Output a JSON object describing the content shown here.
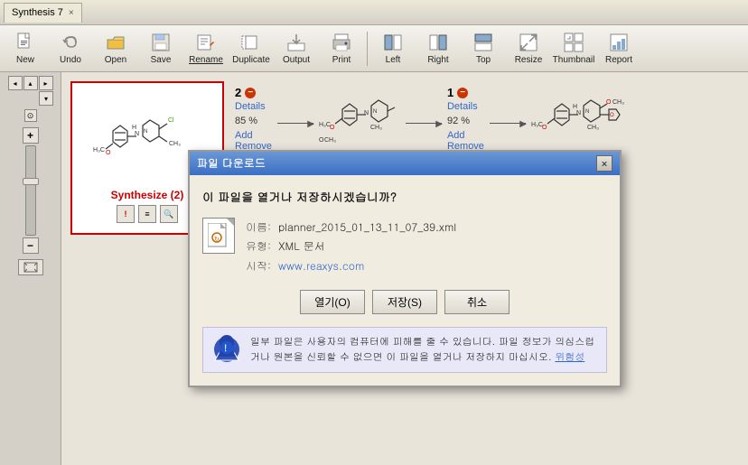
{
  "titlebar": {
    "tab_label": "Synthesis 7",
    "close_label": "×"
  },
  "toolbar": {
    "buttons": [
      {
        "id": "new",
        "label": "New",
        "icon": "📄"
      },
      {
        "id": "undo",
        "label": "Undo",
        "icon": "↩"
      },
      {
        "id": "open",
        "label": "Open",
        "icon": "📂"
      },
      {
        "id": "save",
        "label": "Save",
        "icon": "💾"
      },
      {
        "id": "rename",
        "label": "Rename",
        "icon": "✏️"
      },
      {
        "id": "duplicate",
        "label": "Duplicate",
        "icon": "⧉"
      },
      {
        "id": "output",
        "label": "Output",
        "icon": "⬆"
      },
      {
        "id": "print",
        "label": "Print",
        "icon": "🖨"
      },
      {
        "id": "left",
        "label": "Left",
        "icon": "⬅"
      },
      {
        "id": "right",
        "label": "Right",
        "icon": "➡"
      },
      {
        "id": "top",
        "label": "Top",
        "icon": "⬆"
      },
      {
        "id": "resize",
        "label": "Resize",
        "icon": "⤢"
      },
      {
        "id": "thumbnail",
        "label": "Thumbnail",
        "icon": "🖼"
      },
      {
        "id": "report",
        "label": "Report",
        "icon": "📊"
      }
    ]
  },
  "synthesis": {
    "card_label": "Synthesize (2)",
    "icons": [
      "!",
      "≡",
      "🔍"
    ]
  },
  "steps": [
    {
      "number": "2",
      "details_label": "Details",
      "percent": "85 %",
      "add_label": "Add",
      "remove_label": "Remove"
    },
    {
      "number": "1",
      "details_label": "Details",
      "percent": "92 %",
      "add_label": "Add",
      "remove_label": "Remove"
    }
  ],
  "dialog": {
    "title": "파일 다운로드",
    "close_label": "×",
    "question": "이 파일을 열거나 저장하시겠습니까?",
    "file_name_label": "이름:",
    "file_name": "planner_2015_01_13_11_07_39.xml",
    "file_type_label": "유형:",
    "file_type": "XML 문서",
    "file_source_label": "시작:",
    "file_source": "www.reaxys.com",
    "btn_open": "열기(O)",
    "btn_save": "저장(S)",
    "btn_cancel": "취소",
    "warning_text": "일부 파일은 사용자의 컴퓨터에 피해를 줄 수 있습니다. 파일 정보가 의심스럽거나 원본을 신뢰할 수 없으면 이 파일을 열거나 저장하지 마십시오.",
    "warning_link": "위험성"
  }
}
